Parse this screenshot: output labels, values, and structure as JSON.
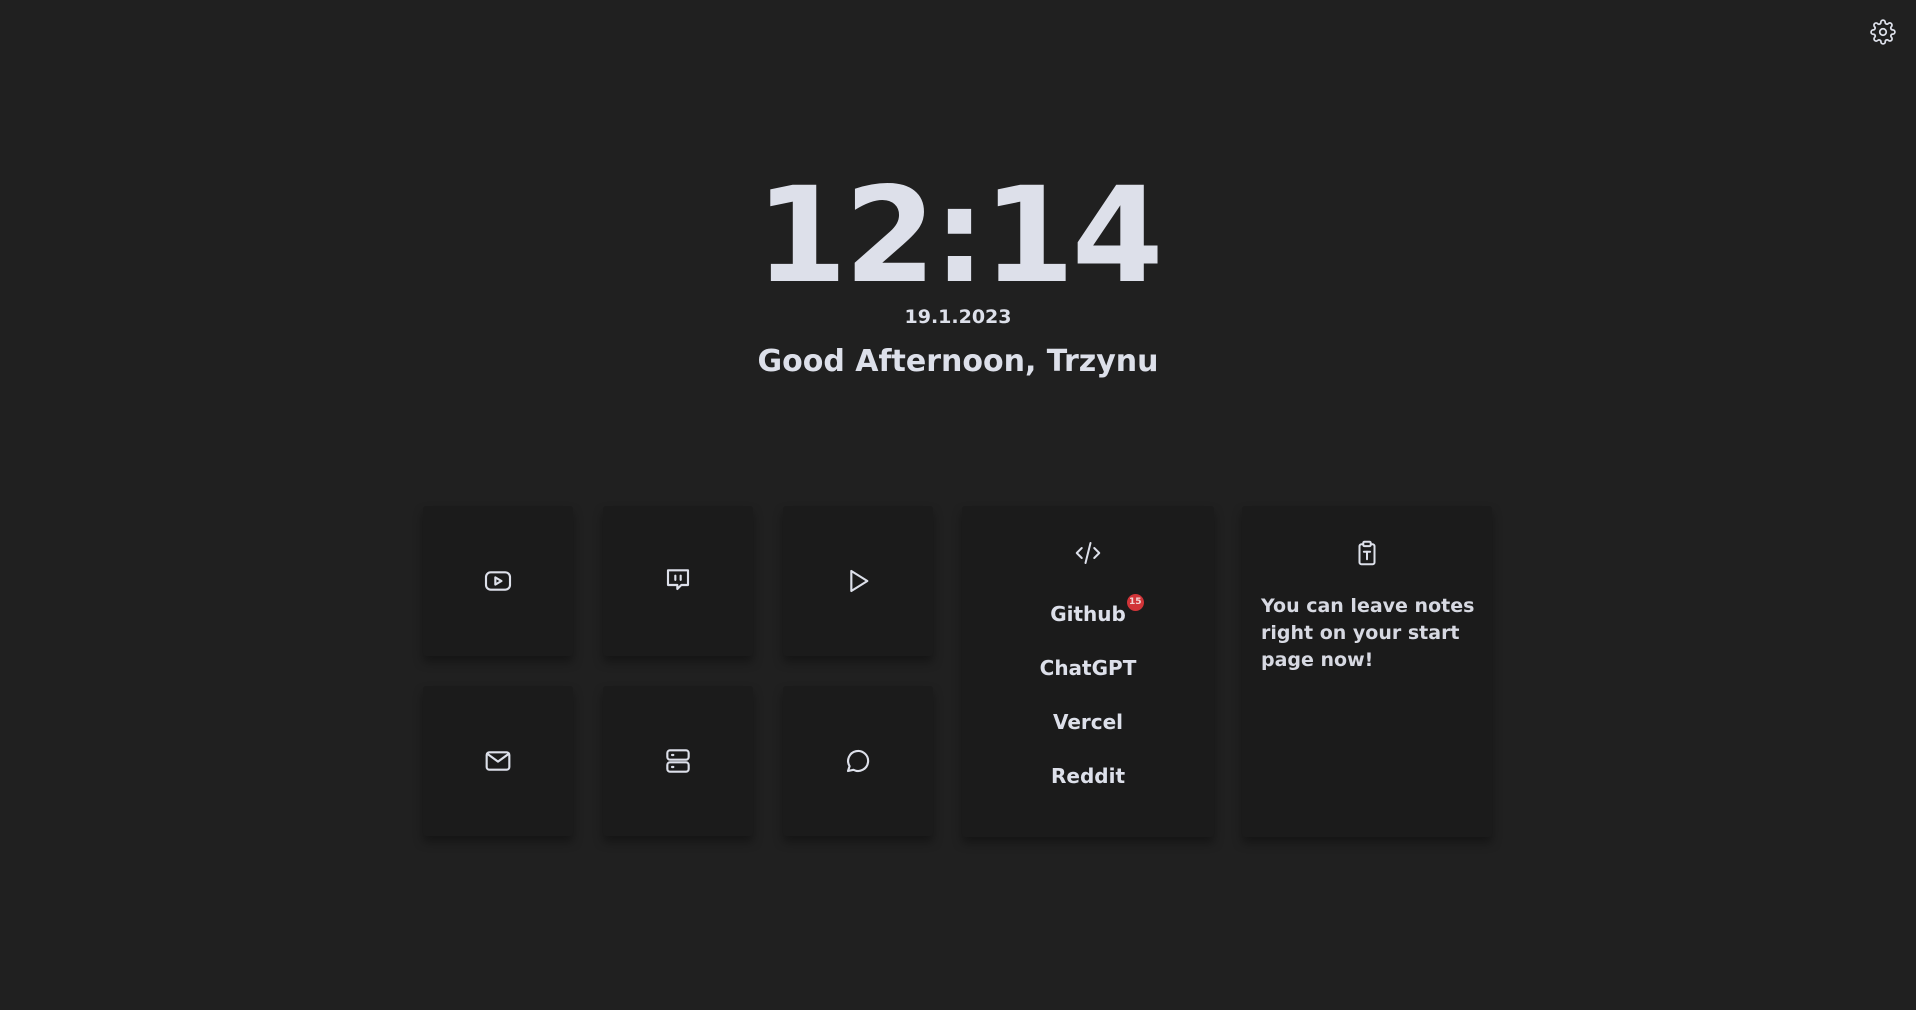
{
  "clock": {
    "time": "12:14",
    "date": "19.1.2023",
    "greeting": "Good Afternoon, Trzynu"
  },
  "toolbar": {
    "settings_icon": "gear-icon"
  },
  "tiles": [
    {
      "icon": "youtube-icon"
    },
    {
      "icon": "twitch-icon"
    },
    {
      "icon": "play-icon"
    },
    {
      "icon": "mail-icon"
    },
    {
      "icon": "server-icon"
    },
    {
      "icon": "chat-bubble-icon"
    }
  ],
  "links": {
    "icon": "code-icon",
    "items": [
      {
        "label": "Github",
        "badge": "15"
      },
      {
        "label": "ChatGPT"
      },
      {
        "label": "Vercel"
      },
      {
        "label": "Reddit"
      }
    ]
  },
  "notes": {
    "icon": "clipboard-text-icon",
    "text": "You can leave notes right on your start page now!"
  },
  "colors": {
    "background": "#202020",
    "card": "#1b1b1b",
    "text": "#dde0ea",
    "badge": "#d13438"
  }
}
